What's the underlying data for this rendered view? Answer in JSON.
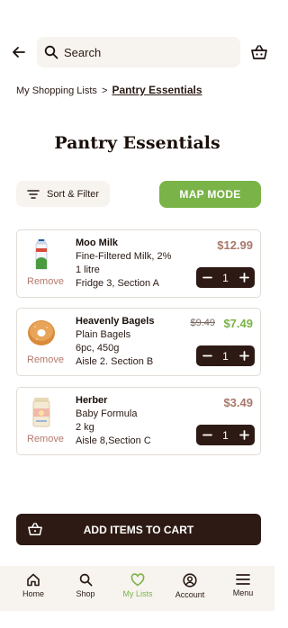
{
  "search": {
    "placeholder": "Search"
  },
  "breadcrumb": {
    "parent": "My Shopping Lists",
    "separator": ">",
    "current": "Pantry Essentials"
  },
  "page_title": "Pantry Essentials",
  "controls": {
    "sort_label": "Sort & Filter",
    "map_label": "MAP MODE"
  },
  "items": [
    {
      "name": "Moo Milk",
      "lines": [
        "Fine-Filtered Milk, 2%",
        "1 litre",
        "Fridge 3, Section A"
      ],
      "price": "$12.99",
      "old_price": "",
      "qty": "1",
      "remove": "Remove"
    },
    {
      "name": "Heavenly Bagels",
      "lines": [
        "Plain Bagels",
        "6pc, 450g",
        "Aisle 2. Section B"
      ],
      "price": "$7.49",
      "old_price": "$9.49",
      "qty": "1",
      "remove": "Remove"
    },
    {
      "name": "Herber",
      "lines": [
        "Baby Formula",
        "2 kg",
        "Aisle 8,Section C"
      ],
      "price": "$3.49",
      "old_price": "",
      "qty": "1",
      "remove": "Remove"
    }
  ],
  "add_to_cart_label": "ADD ITEMS TO CART",
  "nav": [
    {
      "label": "Home",
      "icon": "home-icon"
    },
    {
      "label": "Shop",
      "icon": "search-icon"
    },
    {
      "label": "My Lists",
      "icon": "heart-icon",
      "active": true
    },
    {
      "label": "Account",
      "icon": "account-icon"
    },
    {
      "label": "Menu",
      "icon": "menu-icon"
    }
  ],
  "colors": {
    "accent": "#7ab347",
    "dark": "#2e1a14",
    "price": "#a8786a",
    "surface": "#f7f3ee",
    "remove": "#b5786b"
  }
}
